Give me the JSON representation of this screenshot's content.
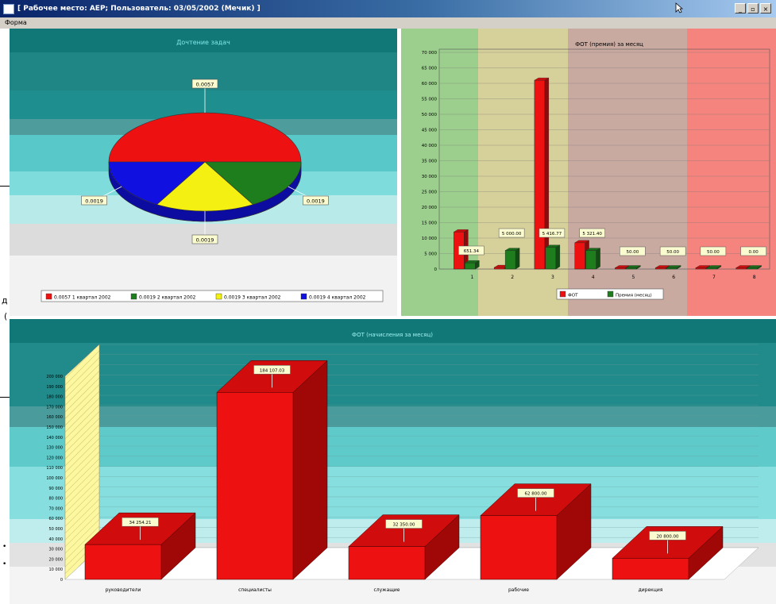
{
  "window": {
    "title": "[ Рабочее место: АЕР; Пользователь: 03/05/2002 (Мечик) ]",
    "menu": [
      "Форма"
    ],
    "buttons": [
      "_",
      "▫",
      "×"
    ]
  },
  "left_edge_fragments": [
    "д",
    "(",
    "•",
    "•"
  ],
  "colors": {
    "red": "#ee1111",
    "green": "#1e7e1e",
    "yellow": "#f4f012",
    "blue": "#1010e0",
    "teal": "#1f8c8c",
    "darkteal": "#0f6f70"
  },
  "chart_data": [
    {
      "type": "pie",
      "title": "Дочтение задач",
      "values": [
        0.0057,
        0.0019,
        0.0019,
        0.0019
      ],
      "data_labels": [
        "0.0057",
        "0.0019",
        "0.0019",
        "0.0019"
      ],
      "legend": [
        "0.0057 1 квартал 2002",
        "0.0019 2 квартал 2002",
        "0.0019 3 квартал 2002",
        "0.0019 4 квартал 2002"
      ],
      "colors": [
        "#ee1111",
        "#1e7e1e",
        "#f4f012",
        "#1010e0"
      ],
      "legend_position": "bottom"
    },
    {
      "type": "bar",
      "title": "ФОТ (премия) за месяц",
      "categories": [
        "1",
        "2",
        "3",
        "4",
        "5",
        "6",
        "7",
        "8"
      ],
      "series": [
        {
          "name": "ФОТ",
          "values": [
            12000,
            500,
            61000,
            8500,
            0,
            0,
            0,
            0
          ]
        },
        {
          "name": "Премия (месяц)",
          "values": [
            2000,
            6000,
            7000,
            6000,
            0,
            0,
            0,
            0
          ]
        }
      ],
      "data_labels": [
        "651.34",
        "5 000.00",
        "5 416.77",
        "5 321.40",
        "50.00",
        "50.00",
        "50.00",
        "0.00"
      ],
      "yticks": [
        "0",
        "5 000",
        "10 000",
        "15 000",
        "20 000",
        "25 000",
        "30 000",
        "35 000",
        "40 000",
        "45 000",
        "50 000",
        "55 000",
        "60 000",
        "65 000",
        "70 000"
      ],
      "ylim": [
        0,
        70000
      ],
      "legend_position": "bottom"
    },
    {
      "type": "bar",
      "title": "ФОТ (начисления за месяц)",
      "categories": [
        "руководители",
        "специалисты",
        "служащие",
        "рабочие",
        "дирекция"
      ],
      "values": [
        34254.21,
        184107.03,
        32350.0,
        62800.0,
        20800.0
      ],
      "data_labels": [
        "34 254.21",
        "184 107.03",
        "32 350.00",
        "62 800.00",
        "20 800.00"
      ],
      "yticks": [
        "0",
        "10 000",
        "20 000",
        "30 000",
        "40 000",
        "50 000",
        "60 000",
        "70 000",
        "80 000",
        "90 000",
        "100 000",
        "110 000",
        "120 000",
        "130 000",
        "140 000",
        "150 000",
        "160 000",
        "170 000",
        "180 000",
        "190 000",
        "200 000"
      ],
      "ylim": [
        0,
        200000
      ]
    }
  ]
}
